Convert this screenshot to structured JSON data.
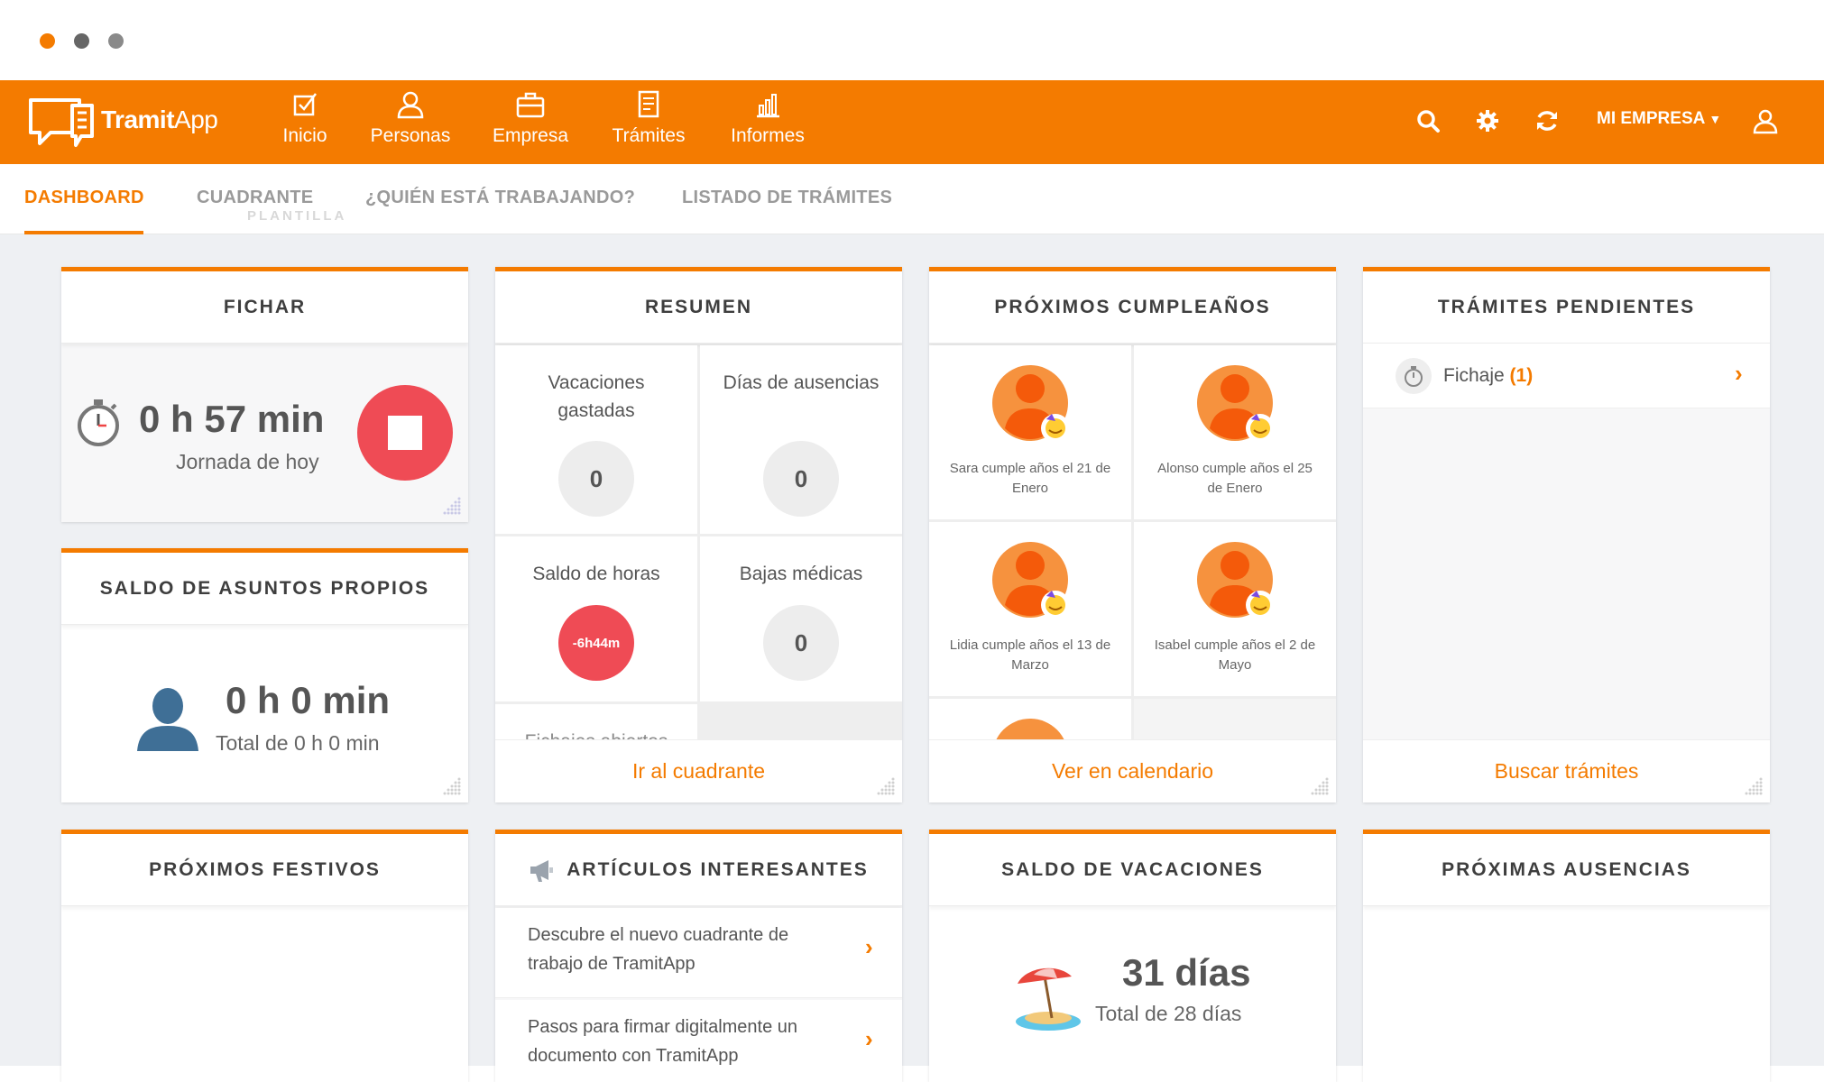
{
  "window": {
    "controls": [
      "close",
      "minimize",
      "maximize"
    ]
  },
  "brand": {
    "name_bold": "Tramit",
    "name_regular": "App",
    "color": "#f47b00"
  },
  "nav": [
    {
      "label": "Inicio",
      "icon": "checkbox-icon"
    },
    {
      "label": "Personas",
      "icon": "person-icon"
    },
    {
      "label": "Empresa",
      "icon": "briefcase-icon"
    },
    {
      "label": "Trámites",
      "icon": "document-icon"
    },
    {
      "label": "Informes",
      "icon": "bar-chart-icon"
    }
  ],
  "topbar": {
    "company_label": "MI EMPRESA",
    "icons": [
      "search-icon",
      "gear-icon",
      "refresh-icon",
      "user-icon"
    ]
  },
  "subtabs": [
    {
      "label": "DASHBOARD",
      "active": true
    },
    {
      "label": "CUADRANTE",
      "active": false
    },
    {
      "label": "¿QUIÉN ESTÁ TRABAJANDO?",
      "active": false
    },
    {
      "label": "LISTADO DE TRÁMITES",
      "active": false
    }
  ],
  "ghost_text": "PLANTILLA",
  "fichar": {
    "title": "FICHAR",
    "time": "0 h 57 min",
    "subtitle": "Jornada de hoy"
  },
  "saldo_asuntos": {
    "title": "SALDO DE ASUNTOS PROPIOS",
    "time": "0 h 0 min",
    "subtitle": "Total de 0 h 0 min"
  },
  "resumen": {
    "title": "RESUMEN",
    "cells": [
      {
        "label": "Vacaciones gastadas",
        "value": "0"
      },
      {
        "label": "Días de ausencias",
        "value": "0"
      },
      {
        "label": "Saldo de horas",
        "value": "-6h44m"
      },
      {
        "label": "Bajas médicas",
        "value": "0"
      }
    ],
    "partial_label": "Fichajes abiertos",
    "footer": "Ir al cuadrante"
  },
  "cumpleanos": {
    "title": "PRÓXIMOS CUMPLEAÑOS",
    "items": [
      {
        "text": "Sara cumple años el 21 de Enero"
      },
      {
        "text": "Alonso cumple años el 25 de Enero"
      },
      {
        "text": "Lidia cumple años el 13 de Marzo"
      },
      {
        "text": "Isabel cumple años el 2 de Mayo"
      }
    ],
    "footer": "Ver en calendario"
  },
  "tramites_pendientes": {
    "title": "TRÁMITES PENDIENTES",
    "row_label": "Fichaje",
    "row_count": "(1)",
    "footer": "Buscar trámites"
  },
  "festivos": {
    "title": "PRÓXIMOS FESTIVOS"
  },
  "articulos": {
    "title": "ARTÍCULOS INTERESANTES",
    "items": [
      {
        "text": "Descubre el nuevo cuadrante de trabajo de TramitApp"
      },
      {
        "text": "Pasos para firmar digitalmente un documento con TramitApp"
      }
    ]
  },
  "vacaciones": {
    "title": "SALDO DE VACACIONES",
    "days": "31 días",
    "subtitle": "Total de 28 días"
  },
  "ausencias": {
    "title": "PRÓXIMAS AUSENCIAS"
  }
}
